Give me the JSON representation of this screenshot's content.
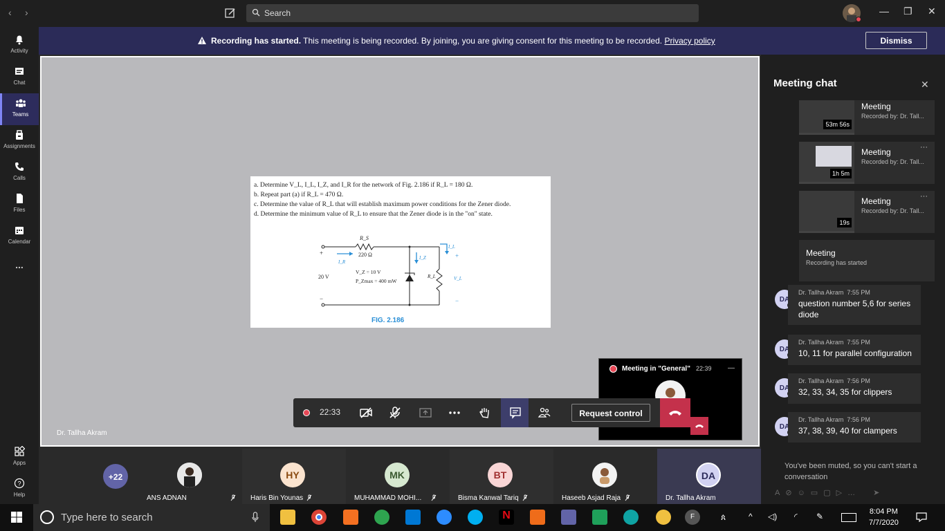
{
  "window": {
    "search_placeholder": "Search",
    "minimize": "—",
    "restore": "❐",
    "close": "✕"
  },
  "rail": [
    {
      "label": "Activity"
    },
    {
      "label": "Chat"
    },
    {
      "label": "Teams"
    },
    {
      "label": "Assignments"
    },
    {
      "label": "Calls"
    },
    {
      "label": "Files"
    },
    {
      "label": "Calendar"
    },
    {
      "label": "..."
    },
    {
      "label": "Apps"
    },
    {
      "label": "Help"
    }
  ],
  "banner": {
    "bold": "Recording has started.",
    "text": " This meeting is being recorded. By joining, you are giving consent for this meeting to be recorded. ",
    "link": "Privacy policy",
    "dismiss": "Dismiss"
  },
  "document": {
    "lines": [
      "a.  Determine V_L, I_L, I_Z, and I_R for the network of Fig. 2.186 if R_L = 180 Ω.",
      "b.  Repeat part (a) if R_L = 470 Ω.",
      "c.  Determine the value of R_L that will establish maximum power conditions for the Zener diode.",
      "d.  Determine the minimum value of R_L to ensure that the Zener diode is in the \"on\" state."
    ],
    "rs_label": "R_S",
    "rs_value": "220 Ω",
    "ir": "I_R",
    "iz": "I_Z",
    "il": "I_L",
    "vz": "V_Z = 10 V",
    "pz": "P_Zmax = 400 mW",
    "source": "20 V",
    "rl": "R_L",
    "vl": "V_L",
    "plus": "+",
    "minus": "−",
    "figcap": "FIG. 2.186"
  },
  "presenter": "Dr. Tallha Akram",
  "toolbar": {
    "time": "22:33",
    "request_control": "Request control"
  },
  "mini": {
    "title": "Meeting in \"General\"",
    "time": "22:39"
  },
  "chat": {
    "title": "Meeting chat",
    "recordings": [
      {
        "title": "Meeting",
        "by": "Recorded by: Dr. Tall...",
        "duration": "53m 56s"
      },
      {
        "title": "Meeting",
        "by": "Recorded by: Dr. Tall...",
        "duration": "1h 5m"
      },
      {
        "title": "Meeting",
        "by": "Recorded by: Dr. Tall...",
        "duration": "19s"
      }
    ],
    "note": {
      "title": "Meeting",
      "sub": "Recording has started"
    },
    "messages": [
      {
        "avatar": "DA",
        "author": "Dr. Tallha Akram",
        "time": "7:55 PM",
        "text": "question number 5,6 for series diode"
      },
      {
        "avatar": "DA",
        "author": "Dr. Tallha Akram",
        "time": "7:55 PM",
        "text": "10, 11 for parallel configuration"
      },
      {
        "avatar": "DA",
        "author": "Dr. Tallha Akram",
        "time": "7:56 PM",
        "text": "32, 33, 34, 35 for clippers"
      },
      {
        "avatar": "DA",
        "author": "Dr. Tallha Akram",
        "time": "7:56 PM",
        "text": "37, 38, 39, 40 for clampers"
      }
    ],
    "muted": "You've been muted, so you can't start a conversation"
  },
  "roster": {
    "extra": "+22",
    "people": [
      {
        "initials": "",
        "name": "ANS ADNAN"
      },
      {
        "initials": "HY",
        "name": "Haris Bin Younas"
      },
      {
        "initials": "MK",
        "name": "MUHAMMAD MOHI..."
      },
      {
        "initials": "BT",
        "name": "Bisma Kanwal Tariq"
      },
      {
        "initials": "",
        "name": "Haseeb Asjad Raja"
      },
      {
        "initials": "DA",
        "name": "Dr. Tallha Akram"
      }
    ]
  },
  "taskbar": {
    "search": "Type here to search",
    "time": "8:04 PM",
    "date": "7/7/2020",
    "user": "F"
  }
}
